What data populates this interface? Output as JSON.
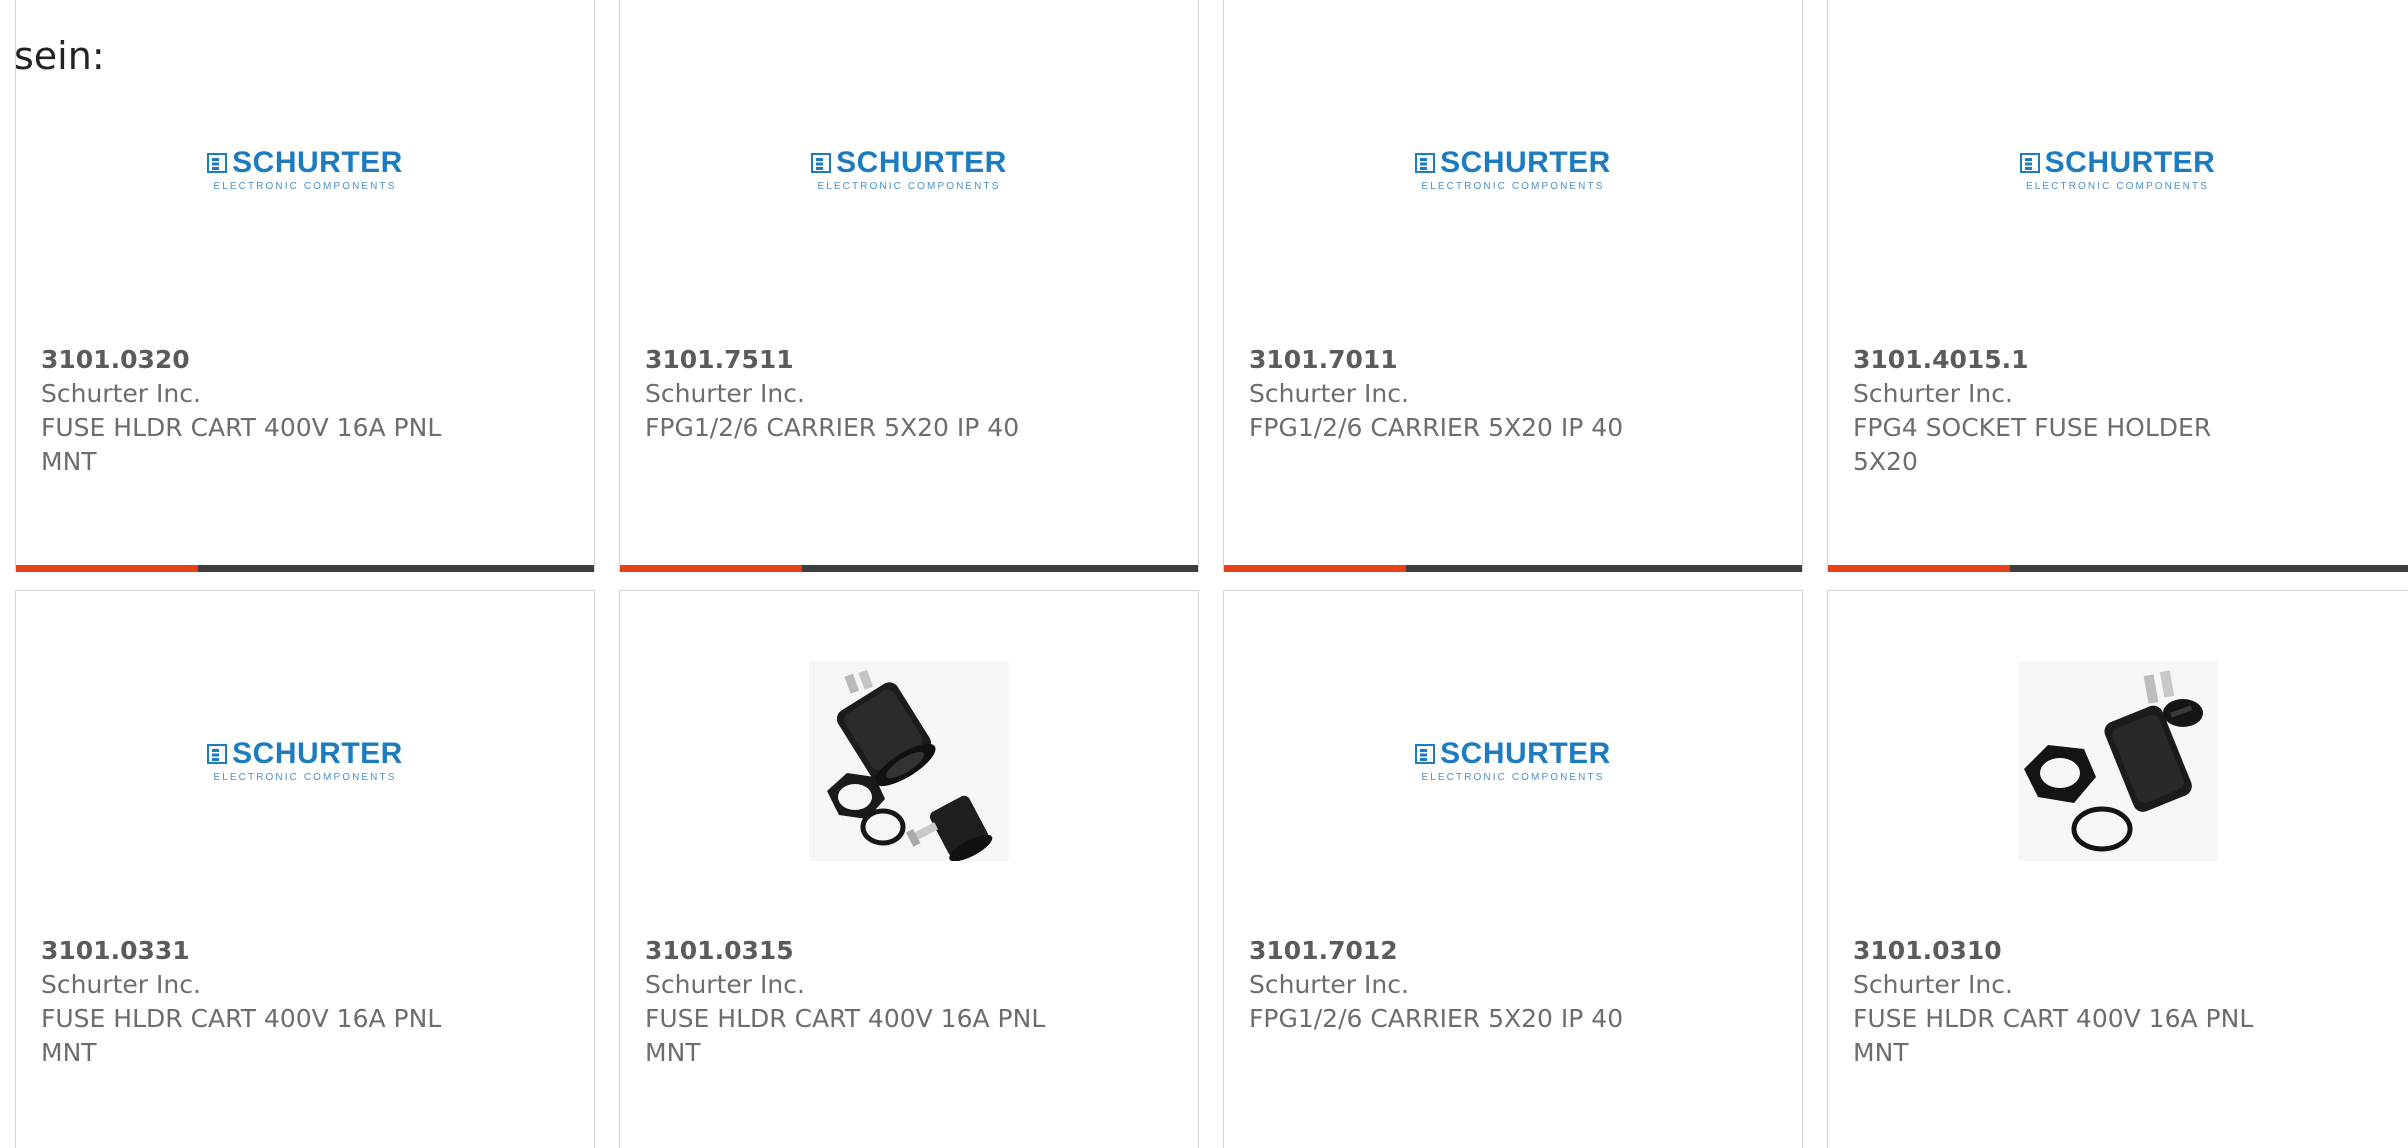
{
  "intro_text": "sein:",
  "brand": {
    "logo_name": "SCHURTER",
    "logo_tagline": "ELECTRONIC COMPONENTS",
    "color": "#1d7bbf"
  },
  "colors": {
    "accent_bar": "#e8411a",
    "dark_bar": "#3e3e3e"
  },
  "products": [
    {
      "part_number": "3101.0320",
      "manufacturer": "Schurter Inc.",
      "description": "FUSE HLDR CART 400V 16A PNL MNT",
      "image": "schurter-logo"
    },
    {
      "part_number": "3101.7511",
      "manufacturer": "Schurter Inc.",
      "description": "FPG1/2/6 CARRIER 5X20 IP 40",
      "image": "schurter-logo"
    },
    {
      "part_number": "3101.7011",
      "manufacturer": "Schurter Inc.",
      "description": "FPG1/2/6 CARRIER 5X20 IP 40",
      "image": "schurter-logo"
    },
    {
      "part_number": "3101.4015.1",
      "manufacturer": "Schurter Inc.",
      "description": "FPG4 SOCKET FUSE HOLDER 5X20",
      "image": "schurter-logo"
    },
    {
      "part_number": "3101.0331",
      "manufacturer": "Schurter Inc.",
      "description": "FUSE HLDR CART 400V 16A PNL MNT",
      "image": "schurter-logo"
    },
    {
      "part_number": "3101.0315",
      "manufacturer": "Schurter Inc.",
      "description": "FUSE HLDR CART 400V 16A PNL MNT",
      "image": "fuse-holder-photo-a"
    },
    {
      "part_number": "3101.7012",
      "manufacturer": "Schurter Inc.",
      "description": "FPG1/2/6 CARRIER 5X20 IP 40",
      "image": "schurter-logo"
    },
    {
      "part_number": "3101.0310",
      "manufacturer": "Schurter Inc.",
      "description": "FUSE HLDR CART 400V 16A PNL MNT",
      "image": "fuse-holder-photo-b"
    }
  ]
}
